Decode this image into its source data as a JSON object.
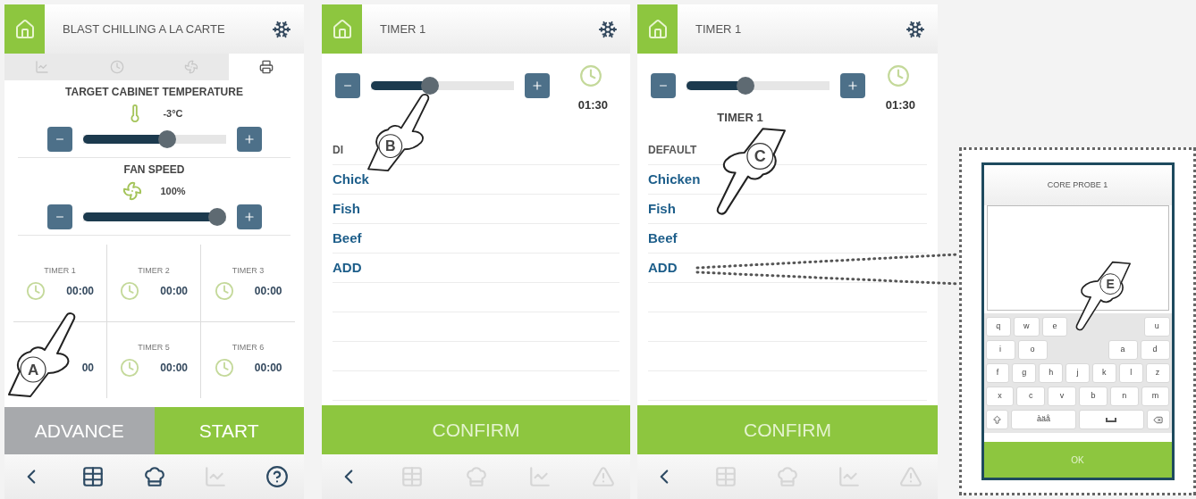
{
  "screens": [
    {
      "kind": "settings",
      "header": {
        "title": "BLAST CHILLING A LA CARTE"
      },
      "tabs": [
        {
          "kind": "chart",
          "selected": false
        },
        {
          "kind": "clock",
          "selected": false
        },
        {
          "kind": "fan",
          "selected": false
        },
        {
          "kind": "printer",
          "selected": true
        }
      ],
      "sections": [
        {
          "kind": "temperature",
          "title": "TARGET CABINET TEMPERATURE",
          "reading": "-3°C",
          "level": 0.6
        },
        {
          "kind": "fan",
          "title": "FAN SPEED",
          "reading": "100%",
          "level": 1
        }
      ],
      "timers": [
        {
          "label": "TIMER 1",
          "value": "00:00"
        },
        {
          "label": "TIMER 2",
          "value": "00:00"
        },
        {
          "label": "TIMER 3",
          "value": "00:00"
        },
        {
          "value": "00"
        },
        {
          "label": "TIMER 5",
          "value": "00:00"
        },
        {
          "label": "TIMER 6",
          "value": "00:00"
        }
      ],
      "buttons": [
        {
          "kind": "secondary",
          "label": "ADVANCE"
        },
        {
          "kind": "primary",
          "label": "START"
        }
      ],
      "nav": [
        {
          "kind": "back",
          "disabled": false
        },
        {
          "kind": "recipes",
          "disabled": false
        },
        {
          "kind": "chef",
          "disabled": false
        },
        {
          "kind": "chart",
          "disabled": true
        },
        {
          "kind": "help",
          "disabled": false
        }
      ],
      "callout": {
        "letter": "A",
        "kind": "up"
      }
    },
    {
      "kind": "timer",
      "header": {
        "title": "TIMER 1"
      },
      "level": 0.4,
      "time": "01:30",
      "list": [
        {
          "kind": "heading",
          "label": "DI"
        },
        {
          "kind": "item",
          "label": "Chick"
        },
        {
          "kind": "item",
          "label": "Fish"
        },
        {
          "kind": "item",
          "label": "Beef"
        },
        {
          "kind": "item",
          "label": "ADD"
        },
        {
          "kind": "blank"
        },
        {
          "kind": "blank"
        },
        {
          "kind": "blank"
        },
        {
          "kind": "blank"
        }
      ],
      "confirm": "CONFIRM",
      "nav": [
        {
          "kind": "back",
          "disabled": false
        },
        {
          "kind": "recipes",
          "disabled": true
        },
        {
          "kind": "chef",
          "disabled": true
        },
        {
          "kind": "chart",
          "disabled": true
        },
        {
          "kind": "alarm",
          "disabled": true
        }
      ],
      "callout": {
        "letter": "B",
        "kind": "up"
      }
    },
    {
      "kind": "timer",
      "header": {
        "title": "TIMER 1"
      },
      "level": 0.4,
      "time": "01:30",
      "subtitle": "TIMER 1",
      "list": [
        {
          "kind": "heading",
          "label": "DEFAULT"
        },
        {
          "kind": "item",
          "label": "Chicken"
        },
        {
          "kind": "item",
          "label": "Fish"
        },
        {
          "kind": "item",
          "label": "Beef"
        },
        {
          "kind": "item",
          "label": "ADD"
        },
        {
          "kind": "blank"
        },
        {
          "kind": "blank"
        },
        {
          "kind": "blank"
        },
        {
          "kind": "blank"
        }
      ],
      "confirm": "CONFIRM",
      "nav": [
        {
          "kind": "back",
          "disabled": false
        },
        {
          "kind": "recipes",
          "disabled": true
        },
        {
          "kind": "chef",
          "disabled": true
        },
        {
          "kind": "chart",
          "disabled": true
        },
        {
          "kind": "alarm",
          "disabled": true
        }
      ],
      "callout": {
        "letter": "C",
        "kind": "down"
      }
    }
  ],
  "dialog": {
    "title": "CORE PROBE 1",
    "keyboard": [
      [
        {
          "kind": "key",
          "label": "q"
        },
        {
          "kind": "key",
          "label": "w"
        },
        {
          "kind": "key",
          "label": "e"
        },
        {
          "kind": "hidden"
        },
        {
          "kind": "key",
          "label": "u"
        }
      ],
      [
        {
          "kind": "key",
          "label": "i"
        },
        {
          "kind": "key",
          "label": "o"
        },
        {
          "kind": "hidden"
        },
        {
          "kind": "key",
          "label": "a"
        },
        {
          "kind": "key",
          "label": "d"
        }
      ],
      [
        {
          "kind": "key",
          "label": "f"
        },
        {
          "kind": "key",
          "label": "g"
        },
        {
          "kind": "key",
          "label": "h"
        },
        {
          "kind": "key",
          "label": "j"
        },
        {
          "kind": "key",
          "label": "k"
        },
        {
          "kind": "key",
          "label": "l"
        },
        {
          "kind": "key",
          "label": "z"
        }
      ],
      [
        {
          "kind": "key",
          "label": "x"
        },
        {
          "kind": "key",
          "label": "c"
        },
        {
          "kind": "key",
          "label": "v"
        },
        {
          "kind": "key",
          "label": "b"
        },
        {
          "kind": "key",
          "label": "n"
        },
        {
          "kind": "key",
          "label": "m"
        }
      ]
    ],
    "bottom_row": [
      {
        "kind": "shift"
      },
      {
        "kind": "symbols",
        "label": "àäå"
      },
      {
        "kind": "space"
      },
      {
        "kind": "backspace"
      }
    ],
    "ok": "OK",
    "callout": {
      "letter": "E",
      "kind": "down"
    }
  }
}
